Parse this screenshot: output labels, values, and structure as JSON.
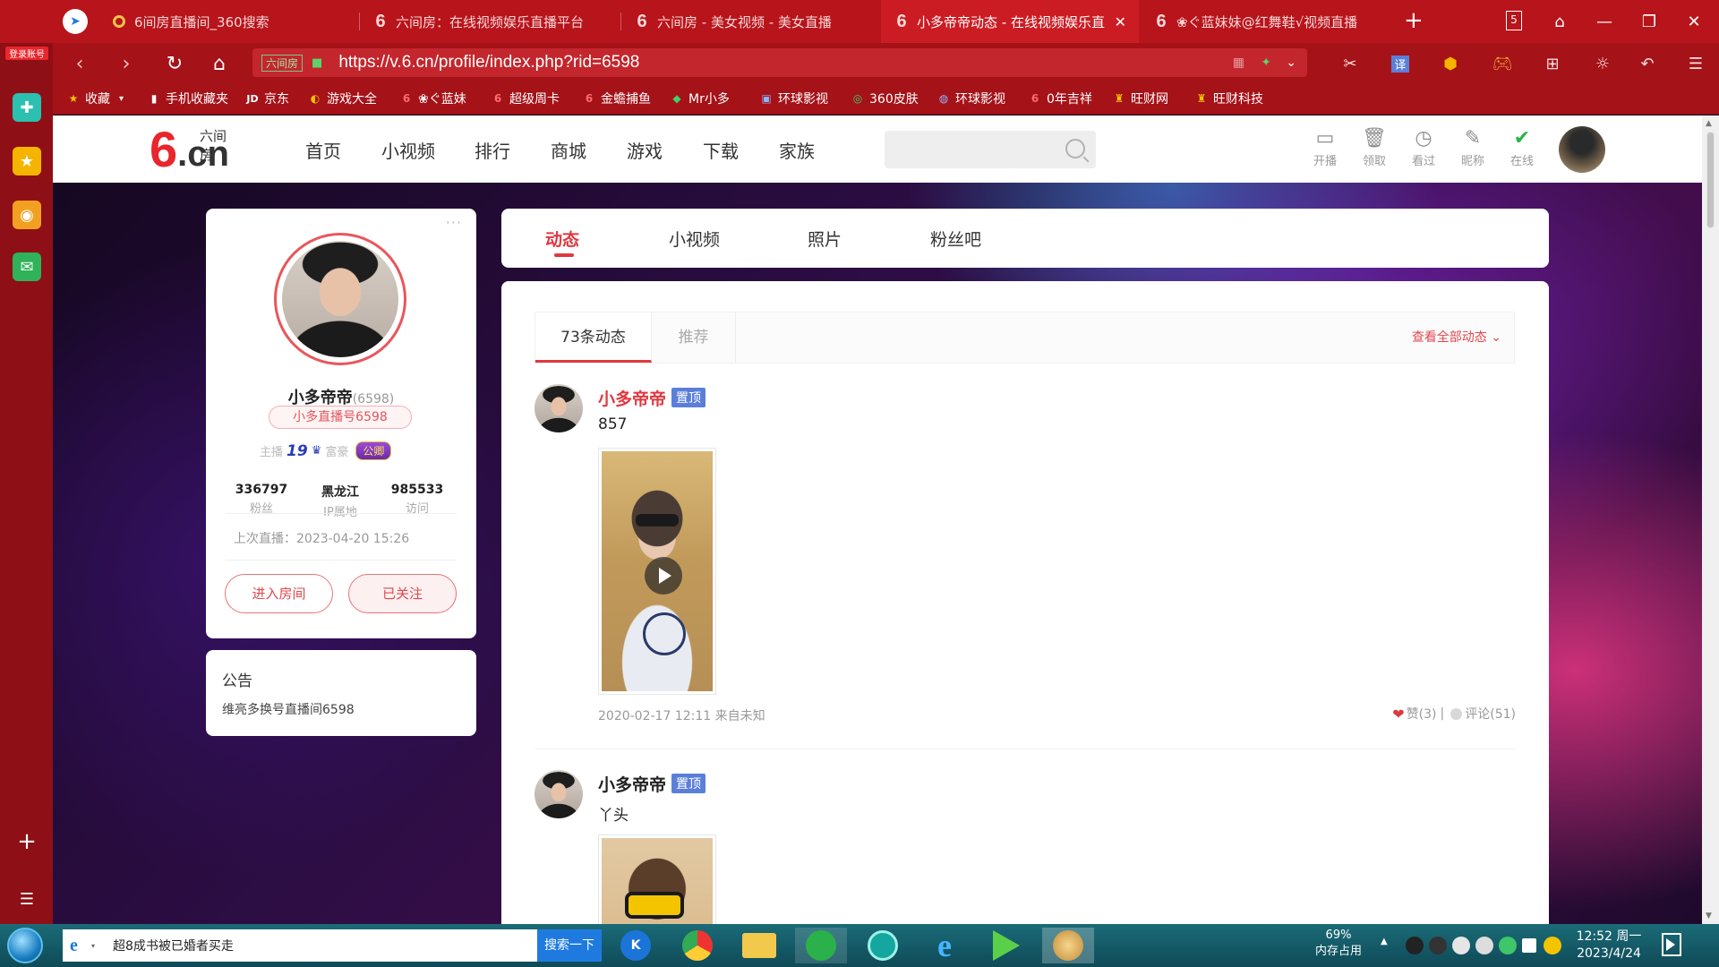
{
  "browser": {
    "logo_label": "登录账号",
    "tabs": [
      {
        "title": "6间房直播间_360搜索",
        "active": false
      },
      {
        "title": "六间房：在线视频娱乐直播平台",
        "active": false
      },
      {
        "title": "六间房 - 美女视频 - 美女直播",
        "active": false
      },
      {
        "title": "小多帝帝动态 - 在线视频娱乐直",
        "active": true
      },
      {
        "title": "❀ぐ蓝妹妹@红舞鞋√视频直播",
        "active": false
      }
    ],
    "tab_counter": "5",
    "url": "https://v.6.cn/profile/index.php?rid=6598",
    "site_tag": "六间房",
    "translate_label": "译",
    "bookmarks": [
      "收藏",
      "手机收藏夹",
      "京东",
      "游戏大全",
      "❀ぐ蓝妹",
      "超级周卡",
      "金蟾捕鱼",
      "Mr小多",
      "环球影视",
      "360皮肤",
      "环球影视",
      "0年吉祥",
      "旺财网",
      "旺财科技"
    ]
  },
  "site": {
    "logo_sub": "六间房",
    "logo_main": "6",
    "logo_cn": ".cn",
    "nav": [
      "首页",
      "小视频",
      "排行",
      "商城",
      "游戏",
      "下载",
      "家族"
    ],
    "search_placeholder": "",
    "header_icons": [
      {
        "label": "开播",
        "icon": "camera-icon"
      },
      {
        "label": "领取",
        "icon": "trash-icon"
      },
      {
        "label": "看过",
        "icon": "clock-icon"
      },
      {
        "label": "昵称",
        "icon": "edit-icon"
      },
      {
        "label": "在线",
        "icon": "check-circle-icon"
      }
    ]
  },
  "profile": {
    "name": "小多帝帝",
    "rid": "(6598)",
    "id_badge": "小多直播号6598",
    "anchor_label": "主播",
    "anchor_level": "19",
    "rich_label": "富豪",
    "guild_label": "公卿",
    "more": "···",
    "stats": [
      {
        "value": "336797",
        "label": "粉丝"
      },
      {
        "value": "黑龙江",
        "label": "IP属地"
      },
      {
        "value": "985533",
        "label": "访问"
      }
    ],
    "last_live": "上次直播：2023-04-20 15:26",
    "enter_button": "进入房间",
    "follow_button": "已关注"
  },
  "notice": {
    "title": "公告",
    "text": "维亮多换号直播间6598"
  },
  "profile_tabs": [
    "动态",
    "小视频",
    "照片",
    "粉丝吧"
  ],
  "feed": {
    "tabs": [
      "73条动态",
      "推荐"
    ],
    "view_all": "查看全部动态",
    "posts": [
      {
        "author": "小多帝帝",
        "pin": "置顶",
        "text": "857",
        "time": "2020-02-17 12:11",
        "source": "来自未知",
        "likes": "赞(3)",
        "comments": "评论(51)"
      },
      {
        "author": "小多帝帝",
        "pin": "置顶",
        "text": "丫头"
      }
    ]
  },
  "taskbar": {
    "search_text": "超8成书被已婚者买走",
    "search_button": "搜索一下",
    "mem_percent": "69%",
    "mem_label": "内存占用",
    "time": "12:52 周一",
    "date": "2023/4/24"
  }
}
